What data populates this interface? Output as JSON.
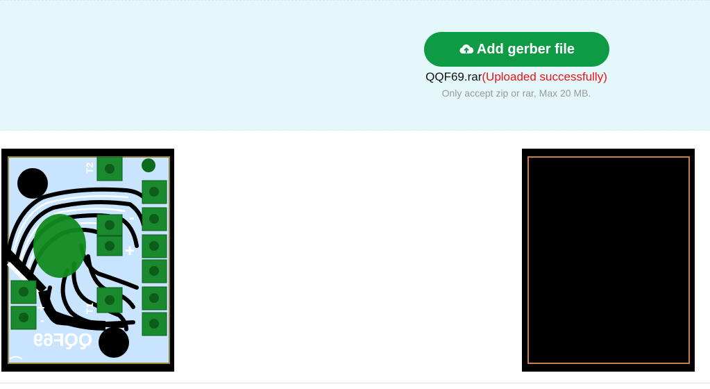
{
  "upload": {
    "button_label": "Add gerber file",
    "button_icon": "cloud-upload-icon",
    "file_name": "QQF69.rar",
    "status_text": "(Uploaded successfully)",
    "hint": "Only accept zip or rar, Max 20 MB.",
    "accent_color": "#0f9b45",
    "status_color": "#e8141b"
  },
  "preview": {
    "top_layer": {
      "board_label": "QQF69",
      "silk_labels": [
        "T2",
        "T1",
        "+",
        "-",
        "+",
        "-"
      ]
    },
    "bottom_layer": {
      "outline_color": "#c8804a"
    }
  }
}
